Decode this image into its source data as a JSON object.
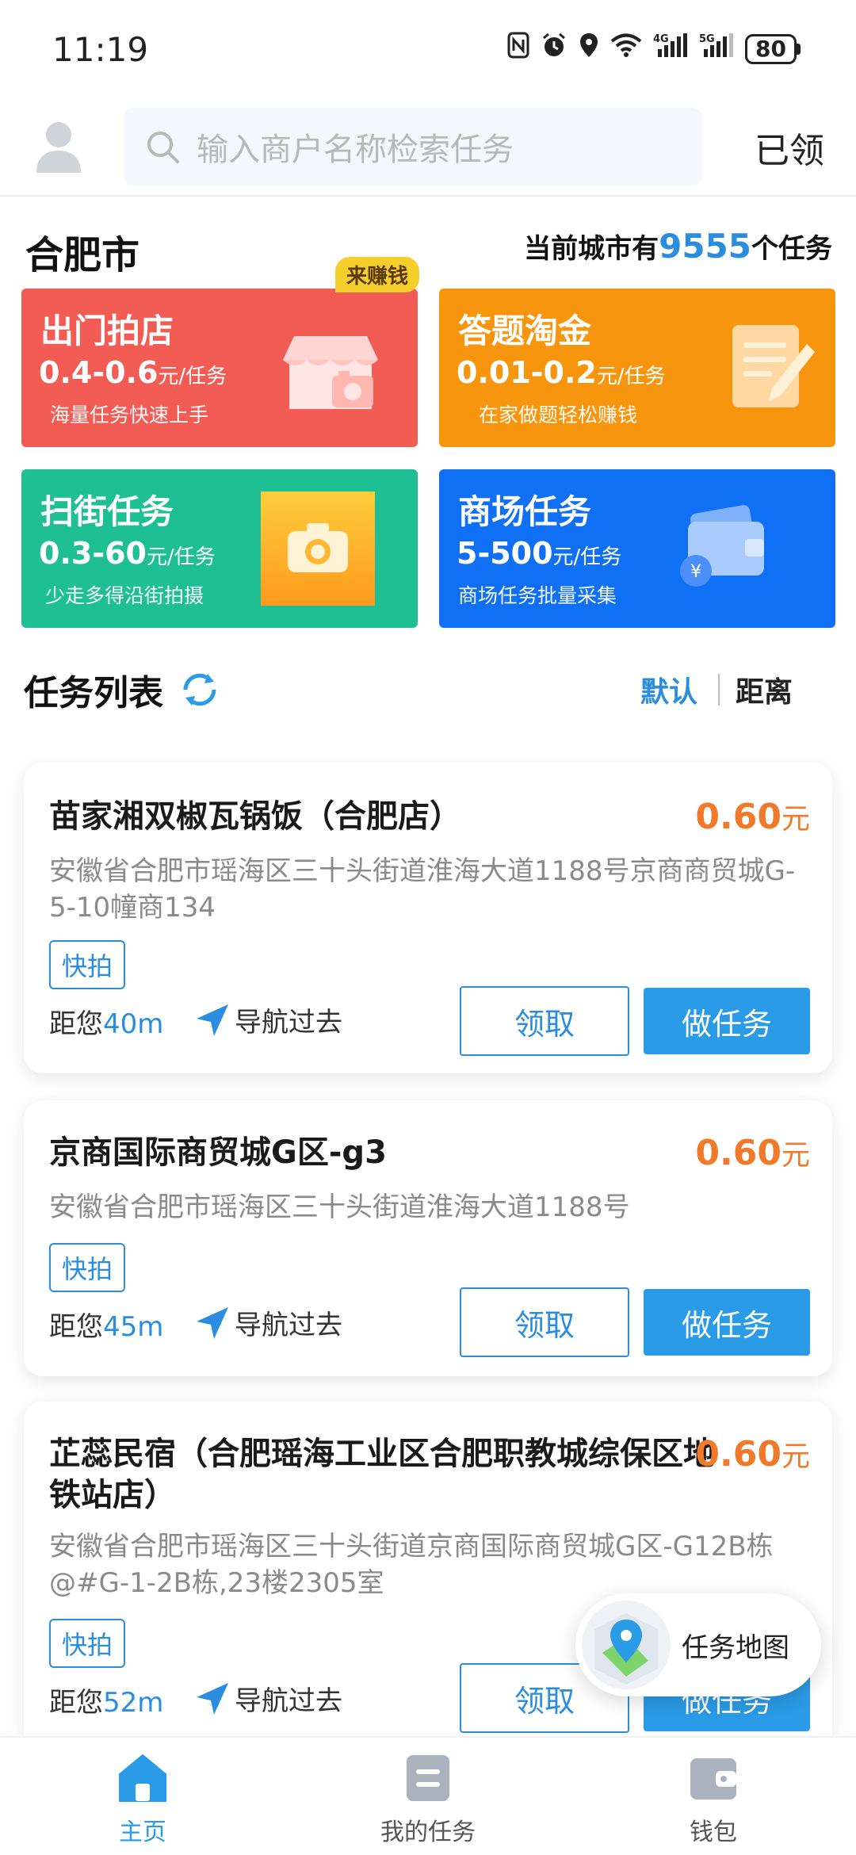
{
  "status_bar": {
    "time": "11:19",
    "icons": [
      "nfc-icon",
      "alarm-icon",
      "location-icon",
      "wifi-icon",
      "4g-signal-icon",
      "5g-signal-icon"
    ],
    "network_4g": "4G",
    "network_5g": "5G",
    "battery": "80"
  },
  "header": {
    "search_placeholder": "输入商户名称检索任务",
    "claimed_label": "已领"
  },
  "city": {
    "name": "合肥市",
    "count_prefix": "当前城市有",
    "count": "9555",
    "count_suffix": "个任务"
  },
  "categories": [
    {
      "title": "出门拍店",
      "price": "0.4-0.6",
      "unit": "元/任务",
      "desc": "海量任务快速上手",
      "badge": "来赚钱",
      "color": "#f35c55"
    },
    {
      "title": "答题淘金",
      "price": "0.01-0.2",
      "unit": "元/任务",
      "desc": "在家做题轻松赚钱",
      "color": "#f7960e"
    },
    {
      "title": "扫街任务",
      "price": "0.3-60",
      "unit": "元/任务",
      "desc": "少走多得沿街拍摄",
      "color": "#1fbf94"
    },
    {
      "title": "商场任务",
      "price": "5-500",
      "unit": "元/任务",
      "desc": "商场任务批量采集",
      "color": "#0f6ff5"
    }
  ],
  "list": {
    "title": "任务列表",
    "sort_default": "默认",
    "sort_distance": "距离"
  },
  "tasks": [
    {
      "name": "苗家湘双椒瓦锅饭（合肥店）",
      "price": "0.60",
      "price_unit": "元",
      "address": "安徽省合肥市瑶海区三十头街道淮海大道1188号京商商贸城G-5-10幢商134",
      "tag": "快拍",
      "distance_prefix": "距您",
      "distance": "40m",
      "nav_label": "导航过去",
      "claim_label": "领取",
      "do_label": "做任务"
    },
    {
      "name": "京商国际商贸城G区-g3",
      "price": "0.60",
      "price_unit": "元",
      "address": "安徽省合肥市瑶海区三十头街道淮海大道1188号",
      "tag": "快拍",
      "distance_prefix": "距您",
      "distance": "45m",
      "nav_label": "导航过去",
      "claim_label": "领取",
      "do_label": "做任务"
    },
    {
      "name": "芷蕊民宿（合肥瑶海工业区合肥职教城综保区地铁站店）",
      "price": "0.60",
      "price_unit": "元",
      "address": "安徽省合肥市瑶海区三十头街道京商国际商贸城G区-G12B栋@#G-1-2B栋,23楼2305室",
      "tag": "快拍",
      "distance_prefix": "距您",
      "distance": "52m",
      "nav_label": "导航过去",
      "claim_label": "领取",
      "do_label": "做任务"
    }
  ],
  "map_button": {
    "label": "任务地图"
  },
  "bottom_nav": [
    {
      "label": "主页",
      "icon": "home-icon",
      "active": true
    },
    {
      "label": "我的任务",
      "icon": "task-list-icon",
      "active": false
    },
    {
      "label": "钱包",
      "icon": "wallet-icon",
      "active": false
    }
  ],
  "colors": {
    "accent": "#2a8de0",
    "price": "#f07a2a",
    "badge": "#f7cf2d"
  }
}
